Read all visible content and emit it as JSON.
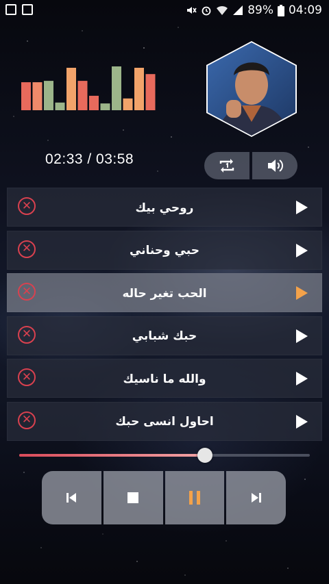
{
  "status_bar": {
    "left_icons": [
      "edit-notification-icon",
      "gallery-notification-icon"
    ],
    "right_icons": [
      "mute-icon",
      "alarm-icon",
      "wifi-icon",
      "signal-icon"
    ],
    "battery": "89%",
    "clock": "04:09"
  },
  "equalizer": {
    "bar_levels": [
      0.62,
      0.62,
      0.65,
      0.17,
      0.94,
      0.65,
      0.32,
      0.15,
      0.97,
      0.26,
      0.94,
      0.8
    ],
    "bar_colors": [
      "#e86a5c",
      "#ef8a6a",
      "#9cb58a",
      "#9cb58a",
      "#f2a36a",
      "#e86a5c",
      "#e86a5c",
      "#9cb58a",
      "#9cb58a",
      "#f2a36a",
      "#f2a36a",
      "#e86a5c"
    ]
  },
  "player": {
    "time_display": "02:33 / 03:58",
    "progress": 0.64,
    "repeat_icon": "repeat-one-icon",
    "volume_icon": "volume-icon"
  },
  "playlist": [
    {
      "title": "روحي بيك",
      "active": false
    },
    {
      "title": "حبي وحناني",
      "active": false
    },
    {
      "title": "الحب تغير حاله",
      "active": true
    },
    {
      "title": "حبك شبابي",
      "active": false
    },
    {
      "title": "والله ما ناسيك",
      "active": false
    },
    {
      "title": "احاول انسى حبك",
      "active": false
    }
  ],
  "transport": {
    "buttons": [
      "previous-icon",
      "stop-icon",
      "pause-icon",
      "next-icon"
    ],
    "accent": "#f4a24a"
  },
  "colors": {
    "delete": "#d9414f",
    "active_play": "#f4a24a"
  }
}
